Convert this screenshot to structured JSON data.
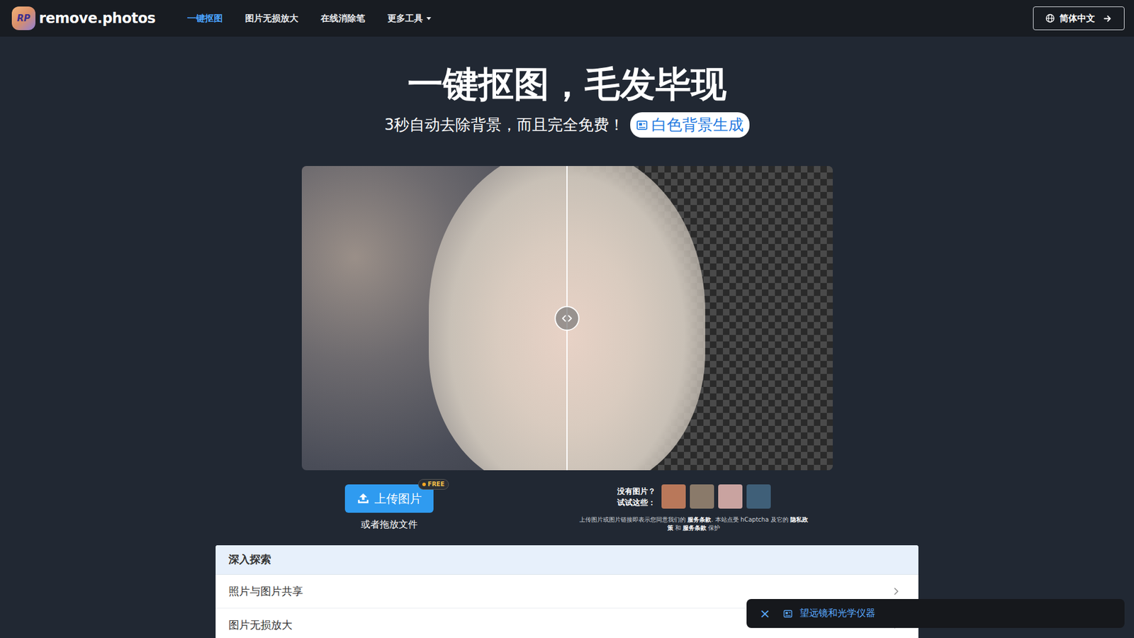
{
  "logo": {
    "mark": "RP",
    "text": "remove.photos"
  },
  "nav": [
    {
      "label": "一键抠图",
      "selected": true,
      "dropdown": false
    },
    {
      "label": "图片无损放大",
      "selected": false,
      "dropdown": false
    },
    {
      "label": "在线消除笔",
      "selected": false,
      "dropdown": false
    },
    {
      "label": "更多工具",
      "selected": false,
      "dropdown": true
    }
  ],
  "language": {
    "label": "简体中文"
  },
  "hero": {
    "title": "一键抠图，毛发毕现",
    "subtitle": "3秒自动去除背景，而且完全免费！",
    "pill": "白色背景生成"
  },
  "compare": {
    "level": 0.5
  },
  "upload": {
    "button": "上传图片",
    "badge": "FREE",
    "hint": "或者拖放文件"
  },
  "samples": {
    "line_1": "没有图片？",
    "line_2": "试试这些：",
    "thumbnails": [
      {
        "color": "#b9785a"
      },
      {
        "color": "#8a7a6a"
      },
      {
        "color": "#c9a3a0"
      },
      {
        "color": "#3f5f78"
      }
    ]
  },
  "terms": [
    {
      "text": "上传图片或图片链接即表示您同意我们的 ",
      "bold": false
    },
    {
      "text": "服务条款",
      "bold": true
    },
    {
      "text": ". 本站点受 hCaptcha 及它的 ",
      "bold": false
    },
    {
      "text": "隐私政策",
      "bold": true
    },
    {
      "text": " 和 ",
      "bold": false
    },
    {
      "text": "服务条款",
      "bold": true
    },
    {
      "text": " 保护",
      "bold": false
    }
  ],
  "explore": {
    "title": "深入探索",
    "items": [
      "照片与图片共享",
      "图片无损放大"
    ]
  },
  "toast": {
    "close": "×",
    "text": "望远镜和光学仪器"
  }
}
